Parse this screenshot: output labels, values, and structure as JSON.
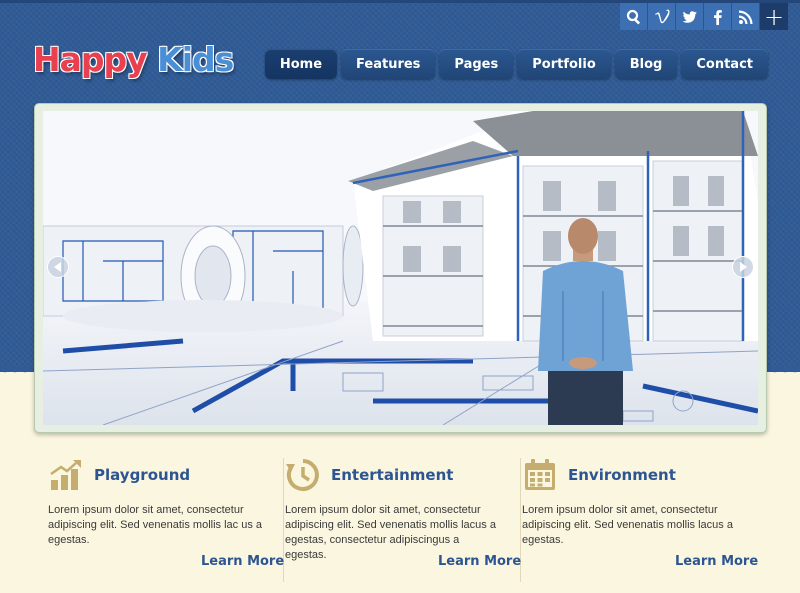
{
  "brand": {
    "part1": "Happy",
    "part2": "Kids"
  },
  "social": {
    "items": [
      "search-icon",
      "vimeo-icon",
      "twitter-icon",
      "facebook-icon",
      "rss-icon"
    ],
    "more": "+"
  },
  "nav": {
    "items": [
      {
        "label": "Home",
        "active": true
      },
      {
        "label": "Features"
      },
      {
        "label": "Pages"
      },
      {
        "label": "Portfolio"
      },
      {
        "label": "Blog"
      },
      {
        "label": "Contact"
      }
    ]
  },
  "slider": {
    "prev_icon": "chevron-left-icon",
    "next_icon": "chevron-right-icon",
    "image": "architect-house-blueprints"
  },
  "features": [
    {
      "icon": "growth-chart-icon",
      "title": "Playground",
      "text": "Lorem ipsum dolor sit amet, consectetur adipiscing elit. Sed venenatis mollis lac us a egestas.",
      "link": "Learn More"
    },
    {
      "icon": "clock-history-icon",
      "title": "Entertainment",
      "text": "Lorem ipsum dolor sit amet, consectetur adipiscing elit. Sed venenatis mollis lacus a egestas, consectetur adipiscingus a egestas.",
      "link": "Learn More"
    },
    {
      "icon": "calendar-icon",
      "title": "Environment",
      "text": "Lorem ipsum dolor sit amet, consectetur adipiscing elit. Sed venenatis mollis lacus a egestas.",
      "link": "Learn More"
    }
  ],
  "colors": {
    "header_blue": "#2f5b96",
    "nav_blue": "#214676",
    "cream": "#faf6df",
    "logo_red": "#e9404f",
    "logo_blue": "#4a8fd6",
    "icon_gold": "#c5ad6f",
    "title_blue": "#2d5591"
  }
}
